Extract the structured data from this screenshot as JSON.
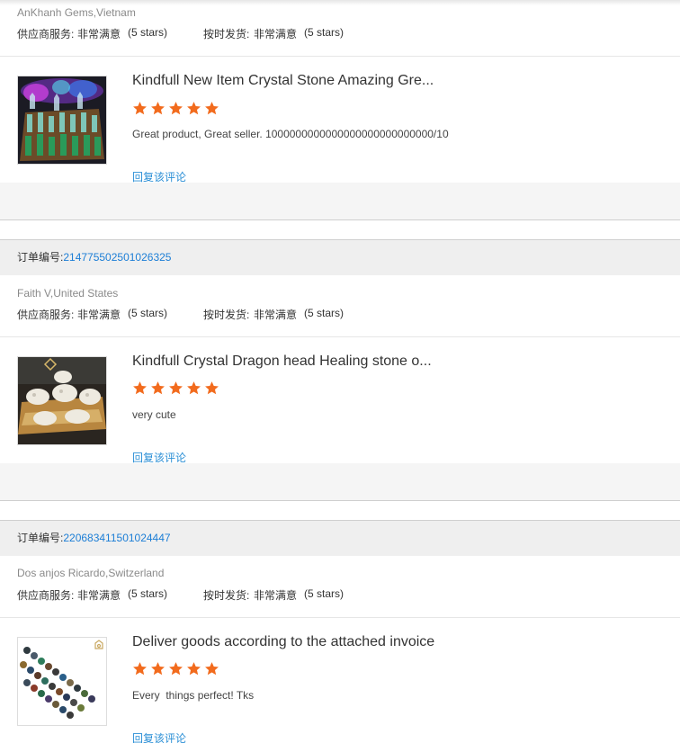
{
  "labels": {
    "order_no": "订单编号:",
    "supplier_service": "供应商服务:",
    "on_time_delivery": "按时发货:",
    "rating_text": "非常满意",
    "stars_text": "(5 stars)",
    "reply": "回复该评论"
  },
  "reviews": [
    {
      "buyer": "AnKhanh Gems,Vietnam",
      "product_title": "Kindfull New Item Crystal Stone Amazing Gre...",
      "rating": 5,
      "comment": "Great product, Great seller. 1000000000000000000000000000/10",
      "thumb_icon": "crystal-towers-photo"
    },
    {
      "order_no": "214775502501026325",
      "buyer": "Faith V,United States",
      "product_title": "Kindfull Crystal Dragon head Healing stone o...",
      "rating": 5,
      "comment": "very cute",
      "thumb_icon": "dragon-head-photo"
    },
    {
      "order_no": "220683411501024447",
      "buyer": "Dos anjos Ricardo,Switzerland",
      "product_title": "Deliver goods according to the attached invoice",
      "rating": 5,
      "comment": "Every  things perfect! Tks",
      "thumb_icon": "bead-bracelets-photo"
    }
  ],
  "colors": {
    "star": "#f26b1d",
    "link": "#1c7ed6"
  }
}
